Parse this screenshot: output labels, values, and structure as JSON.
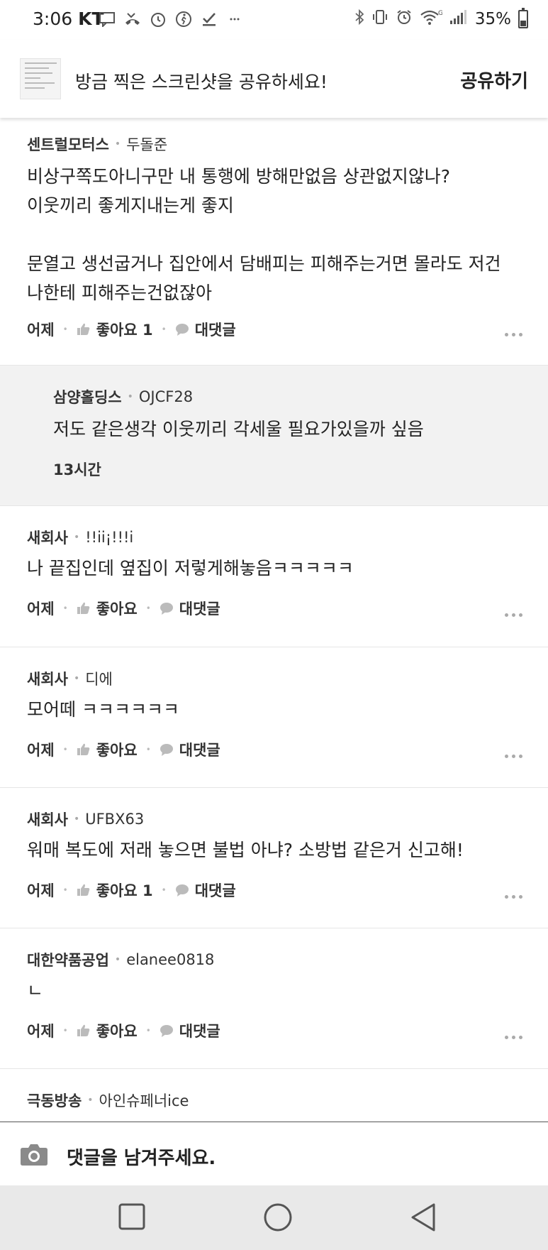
{
  "status_bar": {
    "time": "3:06",
    "carrier": "KT",
    "battery": "35%",
    "left_icons": [
      "message-icon",
      "missed-call-icon",
      "voicemail-icon",
      "fitness-icon",
      "check-icon",
      "more-notifications-icon"
    ],
    "right_icons": [
      "bluetooth-icon",
      "vibrate-icon",
      "alarm-icon",
      "wifi-icon",
      "signal-icon",
      "battery-icon"
    ]
  },
  "share_banner": {
    "text": "방금 찍은 스크린샷을 공유하세요!",
    "button": "공유하기"
  },
  "comments": [
    {
      "company": "센트럴모터스",
      "user": "두돌준",
      "body": "비상구쪽도아니구만 내 통행에 방해만없음 상관없지않나?\n이웃끼리 좋게지내는게 좋지\n\n문열고 생선굽거나 집안에서 담배피는 피해주는거면 몰라도 저건\n나한테 피해주는건없잖아",
      "time": "어제",
      "like": "좋아요 1",
      "reply": "대댓글"
    },
    {
      "company": "삼양홀딩스",
      "user": "OJCF28",
      "body": "저도 같은생각 이웃끼리 각세울 필요가있을까 싶음",
      "time": "13시간"
    },
    {
      "company": "새회사",
      "user": "!!ii¡!!!i",
      "body": "나 끝집인데 옆집이 저렇게해놓음ㅋㅋㅋㅋㅋ",
      "time": "어제",
      "like": "좋아요",
      "reply": "대댓글"
    },
    {
      "company": "새회사",
      "user": "디에",
      "body": "모어떼 ㅋㅋㅋㅋㅋㅋ",
      "time": "어제",
      "like": "좋아요",
      "reply": "대댓글"
    },
    {
      "company": "새회사",
      "user": "UFBX63",
      "body": "워매 복도에 저래 놓으면 불법 아냐? 소방법 같은거 신고해!",
      "time": "어제",
      "like": "좋아요 1",
      "reply": "대댓글"
    },
    {
      "company": "대한약품공업",
      "user": "elanee0818",
      "body": "ㄴ",
      "time": "어제",
      "like": "좋아요",
      "reply": "대댓글"
    },
    {
      "company": "극동방송",
      "user": "아인슈페너ice",
      "body": ""
    }
  ],
  "input_bar": {
    "placeholder": "댓글을 남겨주세요."
  },
  "nav_bar": {
    "buttons": [
      "recent-apps",
      "home",
      "back"
    ]
  }
}
